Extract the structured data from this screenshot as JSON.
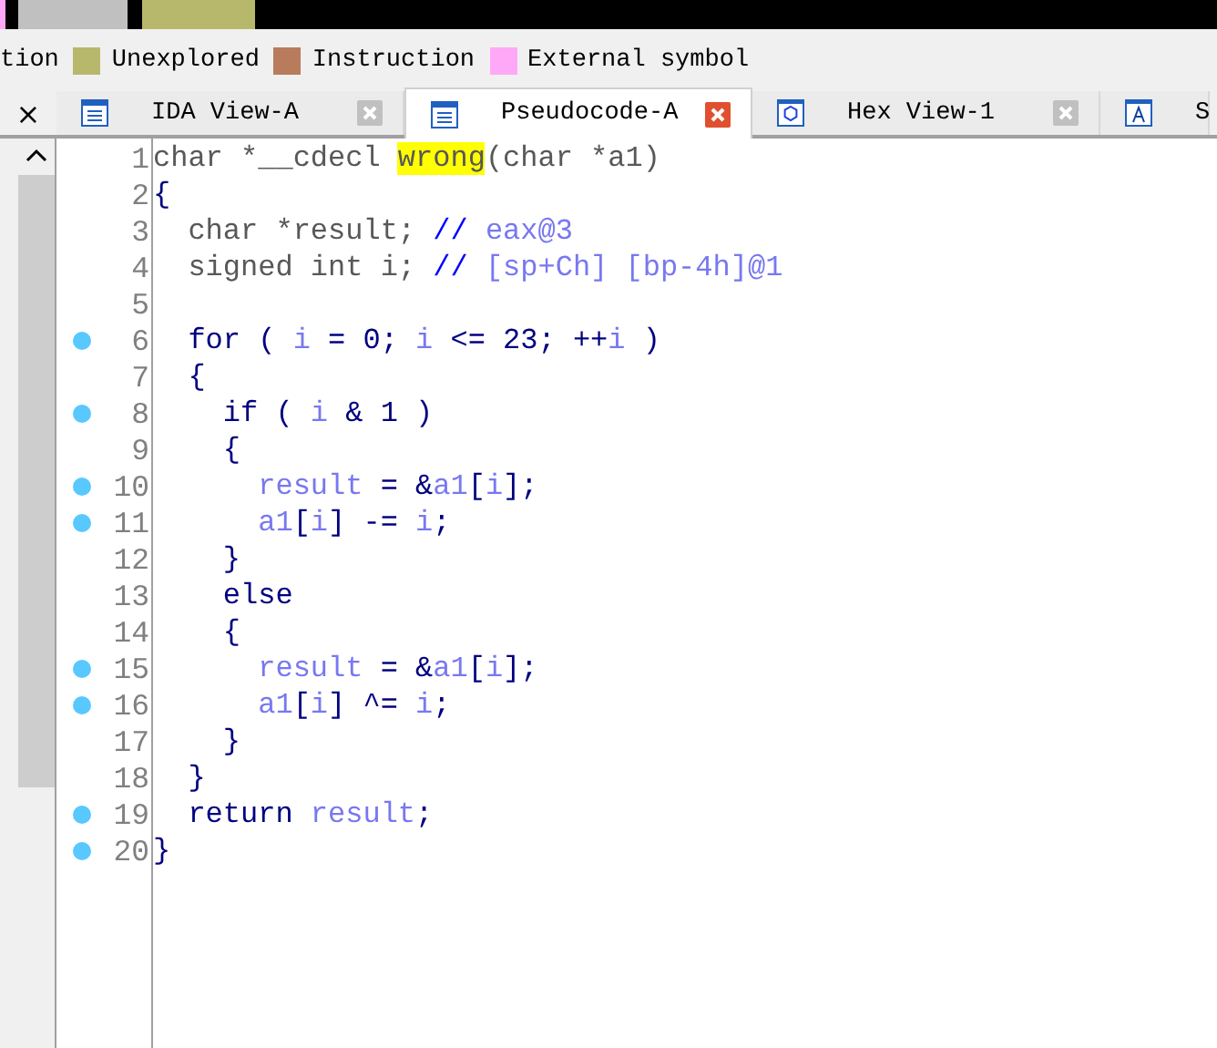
{
  "legend": [
    {
      "label": "tion"
    },
    {
      "label": "Unexplored",
      "color": "#b8b86c"
    },
    {
      "label": "Instruction",
      "color": "#b87c5c"
    },
    {
      "label": "External symbol",
      "color": "#ffa8f8"
    }
  ],
  "left_panel": {
    "close": "×"
  },
  "tabs": [
    {
      "label": "IDA View-A",
      "selected": false,
      "closable": true
    },
    {
      "label": "Pseudocode-A",
      "selected": true,
      "closable": true
    },
    {
      "label": "Hex View-1",
      "selected": false,
      "closable": true
    },
    {
      "label": "S",
      "selected": false,
      "closable": false
    }
  ],
  "code": [
    {
      "number": "1",
      "marker": false,
      "tokens": [
        {
          "text": "char *__cdecl ",
          "kind": "plain"
        },
        {
          "text": "wrong",
          "kind": "highlight"
        },
        {
          "text": "(char *a1)",
          "kind": "plain"
        }
      ]
    },
    {
      "number": "2",
      "marker": false,
      "tokens": [
        {
          "text": "{",
          "kind": "keyword"
        }
      ]
    },
    {
      "number": "3",
      "marker": false,
      "tokens": [
        {
          "text": "  char *result; ",
          "kind": "plain"
        },
        {
          "text": "// ",
          "kind": "comment"
        },
        {
          "text": "eax@3",
          "kind": "variable"
        }
      ]
    },
    {
      "number": "4",
      "marker": false,
      "tokens": [
        {
          "text": "  signed int i; ",
          "kind": "plain"
        },
        {
          "text": "// ",
          "kind": "comment"
        },
        {
          "text": "[sp+Ch] [bp-4h]@1",
          "kind": "variable"
        }
      ]
    },
    {
      "number": "5",
      "marker": false
    },
    {
      "number": "6",
      "marker": true,
      "tokens": [
        {
          "text": "  for ( ",
          "kind": "keyword"
        },
        {
          "text": "i",
          "kind": "variable"
        },
        {
          "text": " = 0; ",
          "kind": "keyword"
        },
        {
          "text": "i",
          "kind": "variable"
        },
        {
          "text": " <= 23; ++",
          "kind": "keyword"
        },
        {
          "text": "i",
          "kind": "variable"
        },
        {
          "text": " )",
          "kind": "keyword"
        }
      ]
    },
    {
      "number": "7",
      "marker": false,
      "tokens": [
        {
          "text": "  {",
          "kind": "keyword"
        }
      ]
    },
    {
      "number": "8",
      "marker": true,
      "tokens": [
        {
          "text": "    if ( ",
          "kind": "keyword"
        },
        {
          "text": "i",
          "kind": "variable"
        },
        {
          "text": " & 1 )",
          "kind": "keyword"
        }
      ]
    },
    {
      "number": "9",
      "marker": false,
      "tokens": [
        {
          "text": "    {",
          "kind": "keyword"
        }
      ]
    },
    {
      "number": "10",
      "marker": true,
      "tokens": [
        {
          "text": "      result",
          "kind": "variable"
        },
        {
          "text": " = &",
          "kind": "keyword"
        },
        {
          "text": "a1",
          "kind": "variable"
        },
        {
          "text": "[",
          "kind": "keyword"
        },
        {
          "text": "i",
          "kind": "variable"
        },
        {
          "text": "];",
          "kind": "keyword"
        }
      ]
    },
    {
      "number": "11",
      "marker": true,
      "tokens": [
        {
          "text": "      a1",
          "kind": "variable"
        },
        {
          "text": "[",
          "kind": "keyword"
        },
        {
          "text": "i",
          "kind": "variable"
        },
        {
          "text": "] -= ",
          "kind": "keyword"
        },
        {
          "text": "i",
          "kind": "variable"
        },
        {
          "text": ";",
          "kind": "keyword"
        }
      ]
    },
    {
      "number": "12",
      "marker": false,
      "tokens": [
        {
          "text": "    }",
          "kind": "keyword"
        }
      ]
    },
    {
      "number": "13",
      "marker": false,
      "tokens": [
        {
          "text": "    else",
          "kind": "keyword"
        }
      ]
    },
    {
      "number": "14",
      "marker": false,
      "tokens": [
        {
          "text": "    {",
          "kind": "keyword"
        }
      ]
    },
    {
      "number": "15",
      "marker": true,
      "tokens": [
        {
          "text": "      result",
          "kind": "variable"
        },
        {
          "text": " = &",
          "kind": "keyword"
        },
        {
          "text": "a1",
          "kind": "variable"
        },
        {
          "text": "[",
          "kind": "keyword"
        },
        {
          "text": "i",
          "kind": "variable"
        },
        {
          "text": "];",
          "kind": "keyword"
        }
      ]
    },
    {
      "number": "16",
      "marker": true,
      "tokens": [
        {
          "text": "      a1",
          "kind": "variable"
        },
        {
          "text": "[",
          "kind": "keyword"
        },
        {
          "text": "i",
          "kind": "variable"
        },
        {
          "text": "] ^= ",
          "kind": "keyword"
        },
        {
          "text": "i",
          "kind": "variable"
        },
        {
          "text": ";",
          "kind": "keyword"
        }
      ]
    },
    {
      "number": "17",
      "marker": false,
      "tokens": [
        {
          "text": "    }",
          "kind": "keyword"
        }
      ]
    },
    {
      "number": "18",
      "marker": false,
      "tokens": [
        {
          "text": "  }",
          "kind": "keyword"
        }
      ]
    },
    {
      "number": "19",
      "marker": true,
      "tokens": [
        {
          "text": "  return ",
          "kind": "keyword"
        },
        {
          "text": "result",
          "kind": "variable"
        },
        {
          "text": ";",
          "kind": "keyword"
        }
      ]
    },
    {
      "number": "20",
      "marker": true,
      "tokens": [
        {
          "text": "}",
          "kind": "keyword"
        }
      ]
    }
  ]
}
